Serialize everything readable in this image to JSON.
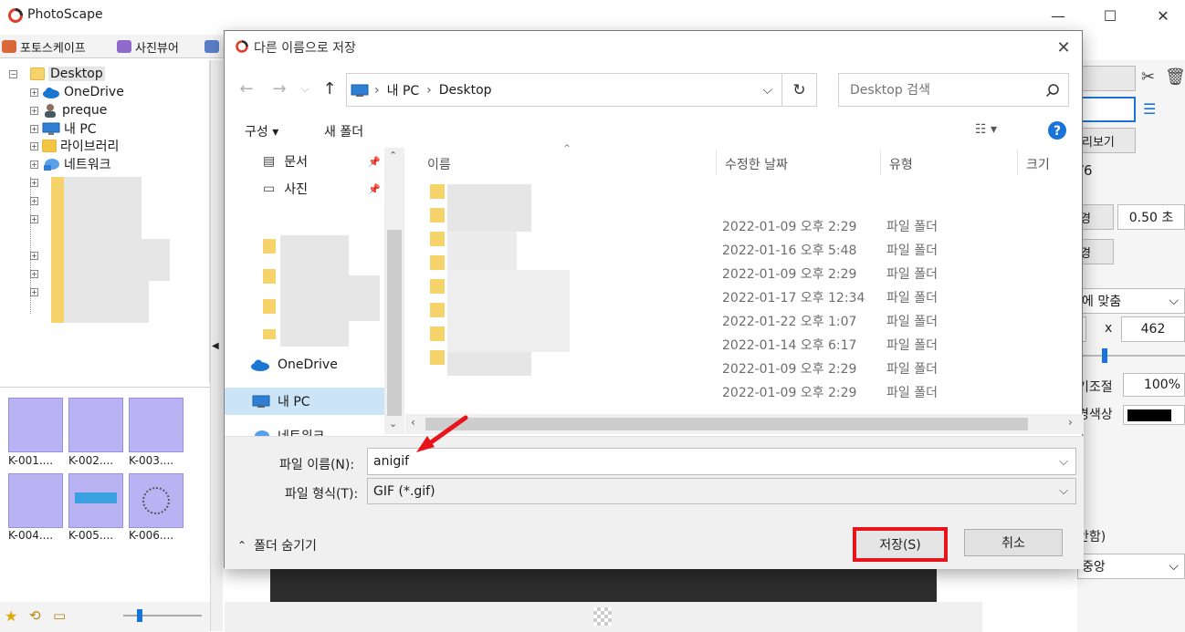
{
  "app": {
    "title": "PhotoScape",
    "tabs": [
      "포토스케이프",
      "사진뷰어"
    ],
    "tree": {
      "root": "Desktop",
      "items": [
        "OneDrive",
        "preque",
        "내 PC",
        "라이브러리",
        "네트워크"
      ]
    },
    "thumbnails": [
      "K-001....",
      "K-002....",
      "K-003....",
      "K-004....",
      "K-005....",
      "K-006...."
    ],
    "right_panel": {
      "counter": "/6",
      "duration": "0.50 초",
      "fit": "에 맞춤",
      "x_sep": "x",
      "height": "462",
      "zoom_label": "기조절",
      "zoom_value": "100%",
      "bg_color_label": "경색상",
      "bottom_text": "안함)",
      "direction": "중앙",
      "preview_label": "리보기"
    }
  },
  "dialog": {
    "title": "다른 이름으로 저장",
    "breadcrumb": [
      "내 PC",
      "Desktop"
    ],
    "search_placeholder": "Desktop 검색",
    "toolbar": {
      "organize": "구성 ▾",
      "new_folder": "새 폴더"
    },
    "nav_items": [
      "문서",
      "사진",
      "OneDrive",
      "내 PC",
      "네트워크"
    ],
    "columns": [
      "이름",
      "수정한 날짜",
      "유형",
      "크기"
    ],
    "files": [
      {
        "date": "2022-01-09 오후 2:29",
        "type": "파일 폴더"
      },
      {
        "date": "2022-01-16 오후 5:48",
        "type": "파일 폴더"
      },
      {
        "date": "2022-01-09 오후 2:29",
        "type": "파일 폴더"
      },
      {
        "date": "2022-01-17 오후 12:34",
        "type": "파일 폴더"
      },
      {
        "date": "2022-01-22 오후 1:07",
        "type": "파일 폴더"
      },
      {
        "date": "2022-01-14 오후 6:17",
        "type": "파일 폴더"
      },
      {
        "date": "2022-01-09 오후 2:29",
        "type": "파일 폴더"
      },
      {
        "date": "2022-01-09 오후 2:29",
        "type": "파일 폴더"
      }
    ],
    "filename_label": "파일 이름(N):",
    "filename_value": "anigif",
    "filetype_label": "파일 형식(T):",
    "filetype_value": "GIF (*.gif)",
    "hide_folders": "폴더 숨기기",
    "save": "저장(S)",
    "cancel": "취소",
    "highlight_color": "#e8141b"
  }
}
